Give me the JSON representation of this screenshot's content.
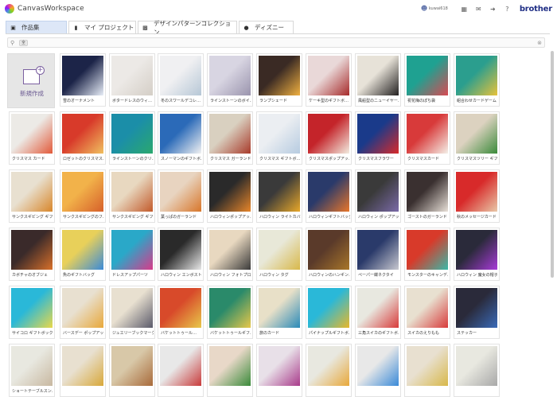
{
  "app": {
    "logo_text": "CanvasWorkspace",
    "user_name": "kuwai618",
    "brand": "brother"
  },
  "tabs": [
    {
      "label": "作品集",
      "icon": "image-icon",
      "active": true
    },
    {
      "label": "マイ プロジェクト",
      "icon": "folder-icon",
      "active": false
    },
    {
      "label": "デザインパターンコレクション",
      "icon": "pattern-icon",
      "active": false
    },
    {
      "label": "ディズニー",
      "icon": "mickey-icon",
      "active": false
    }
  ],
  "search": {
    "chip": "全",
    "placeholder": ""
  },
  "new_project_label": "新規作成",
  "colors": {
    "accent": "#7b5fa0",
    "tab_active_bg": "#dde7f7",
    "brand": "#1f2e85"
  },
  "items": [
    {
      "title": "雪のオーナメント",
      "swatch": [
        "#1c2448",
        "#e8eef8"
      ]
    },
    {
      "title": "ボタードレスのウィ…",
      "swatch": [
        "#ece9e6",
        "#d4cec6"
      ]
    },
    {
      "title": "冬のスワールデコレ…",
      "swatch": [
        "#f0f0f2",
        "#b6c7d6"
      ]
    },
    {
      "title": "ラインストーンのボイ…",
      "swatch": [
        "#d8d5e2",
        "#9a94ad"
      ]
    },
    {
      "title": "ランプシェード",
      "swatch": [
        "#3a2a24",
        "#f0b040"
      ]
    },
    {
      "title": "ケーキ型のギフトボ…",
      "swatch": [
        "#e9d8d8",
        "#a62a2a"
      ]
    },
    {
      "title": "風船型のニューイヤー…",
      "swatch": [
        "#e7e2d8",
        "#232020"
      ]
    },
    {
      "title": "祝花梅のぽち袋",
      "swatch": [
        "#1fa191",
        "#d84a52"
      ]
    },
    {
      "title": "組合わせカードゲーム",
      "swatch": [
        "#2b9e8e",
        "#e7c23a"
      ]
    },
    {
      "title": "クリスマス カード",
      "swatch": [
        "#eceae6",
        "#e25a3a"
      ]
    },
    {
      "title": "ロゼットのクリスマス…",
      "swatch": [
        "#d83a2a",
        "#f0c060"
      ]
    },
    {
      "title": "ラインストーンのクリ…",
      "swatch": [
        "#1b8ea8",
        "#2aa86e"
      ]
    },
    {
      "title": "スノーマンのギフトボ…",
      "swatch": [
        "#2b6ab8",
        "#f2f2f2"
      ]
    },
    {
      "title": "クリスマス ガーランド",
      "swatch": [
        "#d9d0c0",
        "#a83a2a"
      ]
    },
    {
      "title": "クリスマス ギフトボ…",
      "swatch": [
        "#ebeef2",
        "#b6cbe0"
      ]
    },
    {
      "title": "クリスマスポップアッ…",
      "swatch": [
        "#c4242a",
        "#f2ece0"
      ]
    },
    {
      "title": "クリスマスフラワー",
      "swatch": [
        "#1a3a8a",
        "#d82a2a"
      ]
    },
    {
      "title": "クリスマスカード",
      "swatch": [
        "#d83a3a",
        "#f4f0e8"
      ]
    },
    {
      "title": "クリスマスツリー ギフ…",
      "swatch": [
        "#dcd2c0",
        "#3a8a3a"
      ]
    },
    {
      "title": "サンクスギビング ギフ…",
      "swatch": [
        "#e8e0d0",
        "#d8862a"
      ]
    },
    {
      "title": "サンクスギビングのフ…",
      "swatch": [
        "#f2b24a",
        "#d6602a"
      ]
    },
    {
      "title": "サンクスギビング ギフ…",
      "swatch": [
        "#e8d8c0",
        "#c25a2a"
      ]
    },
    {
      "title": "葉っぱのガーランド",
      "swatch": [
        "#e8d4c0",
        "#d8762a"
      ]
    },
    {
      "title": "ハロウィンポップアッ…",
      "swatch": [
        "#2a2a2a",
        "#e8862a"
      ]
    },
    {
      "title": "ハロウィン ライトカバー",
      "swatch": [
        "#3a3a3a",
        "#e8a82a"
      ]
    },
    {
      "title": "ハロウィンギフトバッグ",
      "swatch": [
        "#2a3a6a",
        "#e8762a"
      ]
    },
    {
      "title": "ハロウィン ポップアッ…",
      "swatch": [
        "#3a3a3a",
        "#7a6aa8"
      ]
    },
    {
      "title": "ゴーストのガーランド",
      "swatch": [
        "#3a3030",
        "#e8e0d8"
      ]
    },
    {
      "title": "秋のメッセージカード",
      "swatch": [
        "#d82a2a",
        "#e8c8a8"
      ]
    },
    {
      "title": "カボチャのオブジェ",
      "swatch": [
        "#3a2a2a",
        "#d8702a"
      ]
    },
    {
      "title": "魚のギフトバッグ",
      "swatch": [
        "#e8d05a",
        "#3a8ad8"
      ]
    },
    {
      "title": "ドレスアップパーツ",
      "swatch": [
        "#2aa8c8",
        "#d83a8a"
      ]
    },
    {
      "title": "ハロウィン エンボスト…",
      "swatch": [
        "#2a2a2a",
        "#e8e8e8"
      ]
    },
    {
      "title": "ハロウィン フォトプロ…",
      "swatch": [
        "#e8d8c0",
        "#3a3a3a"
      ]
    },
    {
      "title": "ハロウィン タグ",
      "swatch": [
        "#e8e8d8",
        "#d8b84a"
      ]
    },
    {
      "title": "ハロウィンのハンギン…",
      "swatch": [
        "#5a3a2a",
        "#a8762a"
      ]
    },
    {
      "title": "ペーパー蝶ネクタイ",
      "swatch": [
        "#2a3a6a",
        "#c8c8d0"
      ]
    },
    {
      "title": "モンスターのキャンデ…",
      "swatch": [
        "#d83a2a",
        "#3ab8a8"
      ]
    },
    {
      "title": "ハロウィン 魔女の帽子",
      "swatch": [
        "#2a2a3a",
        "#a83ad8"
      ]
    },
    {
      "title": "サイコロ ギフトボックス",
      "swatch": [
        "#2ab8d8",
        "#e8d84a"
      ]
    },
    {
      "title": "バースデー ポップアッ…",
      "swatch": [
        "#e8e0d0",
        "#e8a83a"
      ]
    },
    {
      "title": "ジュエリーブックマーク",
      "swatch": [
        "#e8e0d0",
        "#5a5a6a"
      ]
    },
    {
      "title": "バケットトゥール…",
      "swatch": [
        "#d84a2a",
        "#e8c84a"
      ]
    },
    {
      "title": "バケットトゥールギフ…",
      "swatch": [
        "#2a8a6a",
        "#e8c84a"
      ]
    },
    {
      "title": "旅のカード",
      "swatch": [
        "#e8e0c8",
        "#2a8ab8"
      ]
    },
    {
      "title": "パイナップルギフトボ…",
      "swatch": [
        "#2ab8d8",
        "#e8b82a"
      ]
    },
    {
      "title": "三角スイカのギフトボ…",
      "swatch": [
        "#e8e8e0",
        "#d83a3a"
      ]
    },
    {
      "title": "スイカのえりもも",
      "swatch": [
        "#e8e0d0",
        "#d83a3a"
      ]
    },
    {
      "title": "ステッカー",
      "swatch": [
        "#2a2a3a",
        "#3a6ab8"
      ]
    },
    {
      "title": "ショートテーブルスン…",
      "swatch": [
        "#e8e8e0",
        "#c8b8a0"
      ]
    },
    {
      "title": "",
      "swatch": [
        "#e8e0d0",
        "#d8a83a"
      ]
    },
    {
      "title": "",
      "swatch": [
        "#d8c8a8",
        "#a86a3a"
      ]
    },
    {
      "title": "",
      "swatch": [
        "#e8e8e8",
        "#c83a3a"
      ]
    },
    {
      "title": "",
      "swatch": [
        "#e8d8c8",
        "#3a8a3a"
      ]
    },
    {
      "title": "",
      "swatch": [
        "#e8e0e8",
        "#a83a8a"
      ]
    },
    {
      "title": "",
      "swatch": [
        "#e8e8e0",
        "#e8a83a"
      ]
    },
    {
      "title": "",
      "swatch": [
        "#e8e8e8",
        "#3a8ad8"
      ]
    },
    {
      "title": "",
      "swatch": [
        "#e8e0d0",
        "#d8b84a"
      ]
    },
    {
      "title": "",
      "swatch": [
        "#e8e8e0",
        "#a8a8a8"
      ]
    }
  ]
}
